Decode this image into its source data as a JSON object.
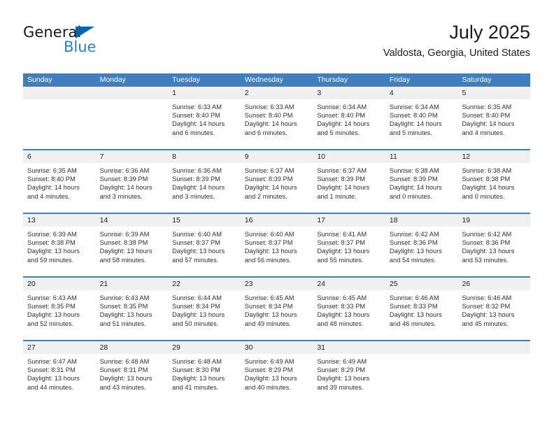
{
  "brand": {
    "name_dark": "General",
    "name_blue": "Blue",
    "triangle_color": "#0a63ab",
    "blue_text_color": "#2a7fc9"
  },
  "header": {
    "title": "July 2025",
    "subtitle": "Valdosta, Georgia, United States",
    "accent_color": "#3f7fbf",
    "day_band_color": "#f0f0f0"
  },
  "weekdays": [
    "Sunday",
    "Monday",
    "Tuesday",
    "Wednesday",
    "Thursday",
    "Friday",
    "Saturday"
  ],
  "weeks": [
    [
      {
        "day": "",
        "sunrise": "",
        "sunset": "",
        "daylight": "",
        "daylight2": ""
      },
      {
        "day": "",
        "sunrise": "",
        "sunset": "",
        "daylight": "",
        "daylight2": ""
      },
      {
        "day": "1",
        "sunrise": "Sunrise: 6:33 AM",
        "sunset": "Sunset: 8:40 PM",
        "daylight": "Daylight: 14 hours",
        "daylight2": "and 6 minutes."
      },
      {
        "day": "2",
        "sunrise": "Sunrise: 6:33 AM",
        "sunset": "Sunset: 8:40 PM",
        "daylight": "Daylight: 14 hours",
        "daylight2": "and 6 minutes."
      },
      {
        "day": "3",
        "sunrise": "Sunrise: 6:34 AM",
        "sunset": "Sunset: 8:40 PM",
        "daylight": "Daylight: 14 hours",
        "daylight2": "and 5 minutes."
      },
      {
        "day": "4",
        "sunrise": "Sunrise: 6:34 AM",
        "sunset": "Sunset: 8:40 PM",
        "daylight": "Daylight: 14 hours",
        "daylight2": "and 5 minutes."
      },
      {
        "day": "5",
        "sunrise": "Sunrise: 6:35 AM",
        "sunset": "Sunset: 8:40 PM",
        "daylight": "Daylight: 14 hours",
        "daylight2": "and 4 minutes."
      }
    ],
    [
      {
        "day": "6",
        "sunrise": "Sunrise: 6:35 AM",
        "sunset": "Sunset: 8:40 PM",
        "daylight": "Daylight: 14 hours",
        "daylight2": "and 4 minutes."
      },
      {
        "day": "7",
        "sunrise": "Sunrise: 6:36 AM",
        "sunset": "Sunset: 8:39 PM",
        "daylight": "Daylight: 14 hours",
        "daylight2": "and 3 minutes."
      },
      {
        "day": "8",
        "sunrise": "Sunrise: 6:36 AM",
        "sunset": "Sunset: 8:39 PM",
        "daylight": "Daylight: 14 hours",
        "daylight2": "and 3 minutes."
      },
      {
        "day": "9",
        "sunrise": "Sunrise: 6:37 AM",
        "sunset": "Sunset: 8:39 PM",
        "daylight": "Daylight: 14 hours",
        "daylight2": "and 2 minutes."
      },
      {
        "day": "10",
        "sunrise": "Sunrise: 6:37 AM",
        "sunset": "Sunset: 8:39 PM",
        "daylight": "Daylight: 14 hours",
        "daylight2": "and 1 minute."
      },
      {
        "day": "11",
        "sunrise": "Sunrise: 6:38 AM",
        "sunset": "Sunset: 8:39 PM",
        "daylight": "Daylight: 14 hours",
        "daylight2": "and 0 minutes."
      },
      {
        "day": "12",
        "sunrise": "Sunrise: 6:38 AM",
        "sunset": "Sunset: 8:38 PM",
        "daylight": "Daylight: 14 hours",
        "daylight2": "and 0 minutes."
      }
    ],
    [
      {
        "day": "13",
        "sunrise": "Sunrise: 6:39 AM",
        "sunset": "Sunset: 8:38 PM",
        "daylight": "Daylight: 13 hours",
        "daylight2": "and 59 minutes."
      },
      {
        "day": "14",
        "sunrise": "Sunrise: 6:39 AM",
        "sunset": "Sunset: 8:38 PM",
        "daylight": "Daylight: 13 hours",
        "daylight2": "and 58 minutes."
      },
      {
        "day": "15",
        "sunrise": "Sunrise: 6:40 AM",
        "sunset": "Sunset: 8:37 PM",
        "daylight": "Daylight: 13 hours",
        "daylight2": "and 57 minutes."
      },
      {
        "day": "16",
        "sunrise": "Sunrise: 6:40 AM",
        "sunset": "Sunset: 8:37 PM",
        "daylight": "Daylight: 13 hours",
        "daylight2": "and 56 minutes."
      },
      {
        "day": "17",
        "sunrise": "Sunrise: 6:41 AM",
        "sunset": "Sunset: 8:37 PM",
        "daylight": "Daylight: 13 hours",
        "daylight2": "and 55 minutes."
      },
      {
        "day": "18",
        "sunrise": "Sunrise: 6:42 AM",
        "sunset": "Sunset: 8:36 PM",
        "daylight": "Daylight: 13 hours",
        "daylight2": "and 54 minutes."
      },
      {
        "day": "19",
        "sunrise": "Sunrise: 6:42 AM",
        "sunset": "Sunset: 8:36 PM",
        "daylight": "Daylight: 13 hours",
        "daylight2": "and 53 minutes."
      }
    ],
    [
      {
        "day": "20",
        "sunrise": "Sunrise: 6:43 AM",
        "sunset": "Sunset: 8:35 PM",
        "daylight": "Daylight: 13 hours",
        "daylight2": "and 52 minutes."
      },
      {
        "day": "21",
        "sunrise": "Sunrise: 6:43 AM",
        "sunset": "Sunset: 8:35 PM",
        "daylight": "Daylight: 13 hours",
        "daylight2": "and 51 minutes."
      },
      {
        "day": "22",
        "sunrise": "Sunrise: 6:44 AM",
        "sunset": "Sunset: 8:34 PM",
        "daylight": "Daylight: 13 hours",
        "daylight2": "and 50 minutes."
      },
      {
        "day": "23",
        "sunrise": "Sunrise: 6:45 AM",
        "sunset": "Sunset: 8:34 PM",
        "daylight": "Daylight: 13 hours",
        "daylight2": "and 49 minutes."
      },
      {
        "day": "24",
        "sunrise": "Sunrise: 6:45 AM",
        "sunset": "Sunset: 8:33 PM",
        "daylight": "Daylight: 13 hours",
        "daylight2": "and 48 minutes."
      },
      {
        "day": "25",
        "sunrise": "Sunrise: 6:46 AM",
        "sunset": "Sunset: 8:33 PM",
        "daylight": "Daylight: 13 hours",
        "daylight2": "and 46 minutes."
      },
      {
        "day": "26",
        "sunrise": "Sunrise: 6:46 AM",
        "sunset": "Sunset: 8:32 PM",
        "daylight": "Daylight: 13 hours",
        "daylight2": "and 45 minutes."
      }
    ],
    [
      {
        "day": "27",
        "sunrise": "Sunrise: 6:47 AM",
        "sunset": "Sunset: 8:31 PM",
        "daylight": "Daylight: 13 hours",
        "daylight2": "and 44 minutes."
      },
      {
        "day": "28",
        "sunrise": "Sunrise: 6:48 AM",
        "sunset": "Sunset: 8:31 PM",
        "daylight": "Daylight: 13 hours",
        "daylight2": "and 43 minutes."
      },
      {
        "day": "29",
        "sunrise": "Sunrise: 6:48 AM",
        "sunset": "Sunset: 8:30 PM",
        "daylight": "Daylight: 13 hours",
        "daylight2": "and 41 minutes."
      },
      {
        "day": "30",
        "sunrise": "Sunrise: 6:49 AM",
        "sunset": "Sunset: 8:29 PM",
        "daylight": "Daylight: 13 hours",
        "daylight2": "and 40 minutes."
      },
      {
        "day": "31",
        "sunrise": "Sunrise: 6:49 AM",
        "sunset": "Sunset: 8:29 PM",
        "daylight": "Daylight: 13 hours",
        "daylight2": "and 39 minutes."
      },
      {
        "day": "",
        "sunrise": "",
        "sunset": "",
        "daylight": "",
        "daylight2": ""
      },
      {
        "day": "",
        "sunrise": "",
        "sunset": "",
        "daylight": "",
        "daylight2": ""
      }
    ]
  ]
}
